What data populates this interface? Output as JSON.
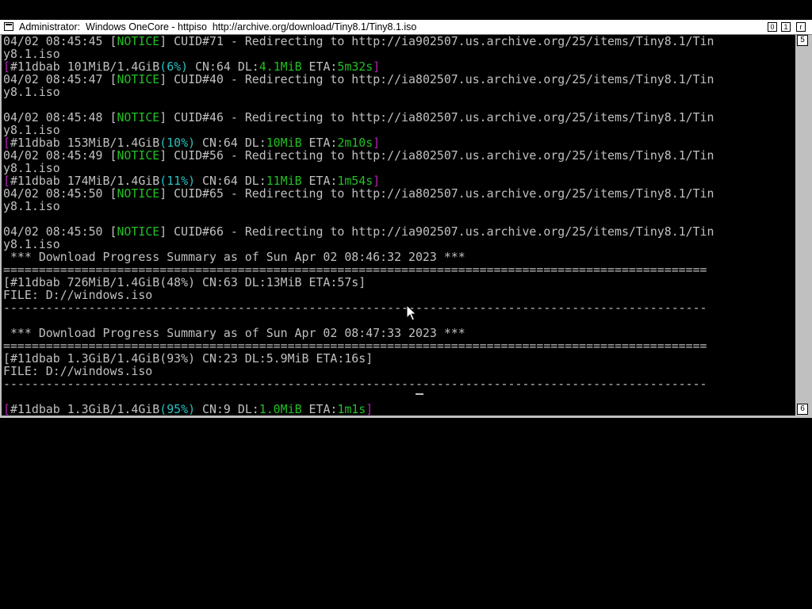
{
  "window": {
    "title": "Administrator:  Windows OneCore - httpiso  http://archive.org/download/Tiny8.1/Tiny8.1.iso",
    "buttons": {
      "minimize": "0",
      "maximize": "1",
      "close": "r"
    }
  },
  "scrollbar": {
    "up": "5",
    "down": "6"
  },
  "console": {
    "l1": {
      "a": "04/02 08:45:45 [",
      "b": "NOTICE",
      "c": "] CUID#71 - Redirecting to http://ia902507.us.archive.org/25/items/Tiny8.1/Tin"
    },
    "l2": {
      "a": "y8.1.iso"
    },
    "l3": {
      "a": "[",
      "b": "#11dbab 101MiB/1.4GiB",
      "c": "(6%)",
      "d": " CN:64 DL:",
      "e": "4.1MiB",
      "f": " ETA:",
      "g": "5m32s",
      "h": "]"
    },
    "l4": {
      "a": "04/02 08:45:47 [",
      "b": "NOTICE",
      "c": "] CUID#40 - Redirecting to http://ia802507.us.archive.org/25/items/Tiny8.1/Tin"
    },
    "l5": {
      "a": "y8.1.iso"
    },
    "l7": {
      "a": "04/02 08:45:48 [",
      "b": "NOTICE",
      "c": "] CUID#46 - Redirecting to http://ia802507.us.archive.org/25/items/Tiny8.1/Tin"
    },
    "l8": {
      "a": "y8.1.iso"
    },
    "l9": {
      "a": "[",
      "b": "#11dbab 153MiB/1.4GiB",
      "c": "(10%)",
      "d": " CN:64 DL:",
      "e": "10MiB",
      "f": " ETA:",
      "g": "2m10s",
      "h": "]"
    },
    "l10": {
      "a": "04/02 08:45:49 [",
      "b": "NOTICE",
      "c": "] CUID#56 - Redirecting to http://ia802507.us.archive.org/25/items/Tiny8.1/Tin"
    },
    "l11": {
      "a": "y8.1.iso"
    },
    "l12": {
      "a": "[",
      "b": "#11dbab 174MiB/1.4GiB",
      "c": "(11%)",
      "d": " CN:64 DL:",
      "e": "11MiB",
      "f": " ETA:",
      "g": "1m54s",
      "h": "]"
    },
    "l13": {
      "a": "04/02 08:45:50 [",
      "b": "NOTICE",
      "c": "] CUID#65 - Redirecting to http://ia802507.us.archive.org/25/items/Tiny8.1/Tin"
    },
    "l14": {
      "a": "y8.1.iso"
    },
    "l16": {
      "a": "04/02 08:45:50 [",
      "b": "NOTICE",
      "c": "] CUID#66 - Redirecting to http://ia902507.us.archive.org/25/items/Tiny8.1/Tin"
    },
    "l17": {
      "a": "y8.1.iso"
    },
    "l18": {
      "a": " *** Download Progress Summary as of Sun Apr 02 08:46:32 2023 ***"
    },
    "l19": {
      "a": "==================================================================================================="
    },
    "l20": {
      "a": "[#11dbab 726MiB/1.4GiB(48%) CN:63 DL:13MiB ETA:57s]"
    },
    "l21": {
      "a": "FILE: D://windows.iso"
    },
    "l22": {
      "a": "---------------------------------------------------------------------------------------------------"
    },
    "l24": {
      "a": " *** Download Progress Summary as of Sun Apr 02 08:47:33 2023 ***"
    },
    "l25": {
      "a": "==================================================================================================="
    },
    "l26": {
      "a": "[#11dbab 1.3GiB/1.4GiB(93%) CN:23 DL:5.9MiB ETA:16s]"
    },
    "l27": {
      "a": "FILE: D://windows.iso"
    },
    "l28": {
      "a": "---------------------------------------------------------------------------------------------------"
    },
    "l30": {
      "a": "[",
      "b": "#11dbab 1.3GiB/1.4GiB",
      "c": "(95%)",
      "d": " CN:9 DL:",
      "e": "1.0MiB",
      "f": " ETA:",
      "g": "1m1s",
      "h": "]"
    }
  },
  "colors": {
    "notice": "#22c022",
    "percent": "#2ac0c0",
    "bracket": "#b820b8",
    "text": "#c0c0c0",
    "background": "#000000"
  },
  "icons": {
    "system_menu": "window-icon",
    "pointer": "mouse-pointer-icon"
  }
}
